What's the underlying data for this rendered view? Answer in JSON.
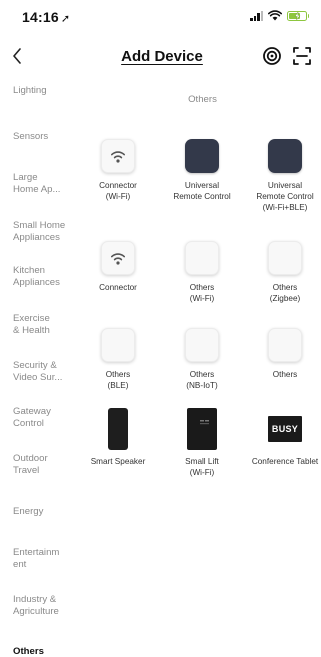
{
  "status_bar": {
    "time": "14:16",
    "location_arrow": "➚",
    "battery_color": "#8dc63f"
  },
  "nav": {
    "title": "Add Device",
    "back_icon": "chevron-left-icon",
    "scan_icon": "target-scan-icon",
    "qr_icon": "qr-scan-icon"
  },
  "sidebar": {
    "items": [
      {
        "label": "Lighting",
        "active": false
      },
      {
        "label": "Sensors",
        "active": false
      },
      {
        "label": "Large\nHome Ap...",
        "active": false
      },
      {
        "label": "Small Home\nAppliances",
        "active": false
      },
      {
        "label": "Kitchen\nAppliances",
        "active": false
      },
      {
        "label": "Exercise\n& Health",
        "active": false
      },
      {
        "label": "Security &\nVideo Sur...",
        "active": false
      },
      {
        "label": "Gateway\nControl",
        "active": false
      },
      {
        "label": "Outdoor\nTravel",
        "active": false
      },
      {
        "label": "Energy",
        "active": false
      },
      {
        "label": "Entertainm\nent",
        "active": false
      },
      {
        "label": "Industry &\nAgriculture",
        "active": false
      },
      {
        "label": "Others",
        "active": true
      }
    ]
  },
  "main": {
    "section_title": "Others",
    "devices": [
      {
        "label": "Connector\n(Wi-Fi)",
        "icon": "wifi-icon",
        "style": "white"
      },
      {
        "label": "Universal\nRemote Control",
        "icon": "remote-icon",
        "style": "dark"
      },
      {
        "label": "Universal\nRemote Control\n(Wi-Fi+BLE)",
        "icon": "remote-icon",
        "style": "dark"
      },
      {
        "label": "Connector",
        "icon": "wifi-icon",
        "style": "white"
      },
      {
        "label": "Others\n(Wi-Fi)",
        "icon": "blank-device-icon",
        "style": "white"
      },
      {
        "label": "Others\n(Zigbee)",
        "icon": "blank-device-icon",
        "style": "white"
      },
      {
        "label": "Others\n(BLE)",
        "icon": "blank-device-icon",
        "style": "white"
      },
      {
        "label": "Others\n(NB-IoT)",
        "icon": "blank-device-icon",
        "style": "white"
      },
      {
        "label": "Others",
        "icon": "blank-device-icon",
        "style": "white"
      },
      {
        "label": "Smart Speaker",
        "icon": "speaker-icon",
        "style": "speaker"
      },
      {
        "label": "Small Lift\n(Wi-Fi)",
        "icon": "lift-icon",
        "style": "lift"
      },
      {
        "label": "Conference Tablet",
        "icon": "busy-tablet-icon",
        "style": "busy",
        "badge": "BUSY"
      }
    ]
  }
}
